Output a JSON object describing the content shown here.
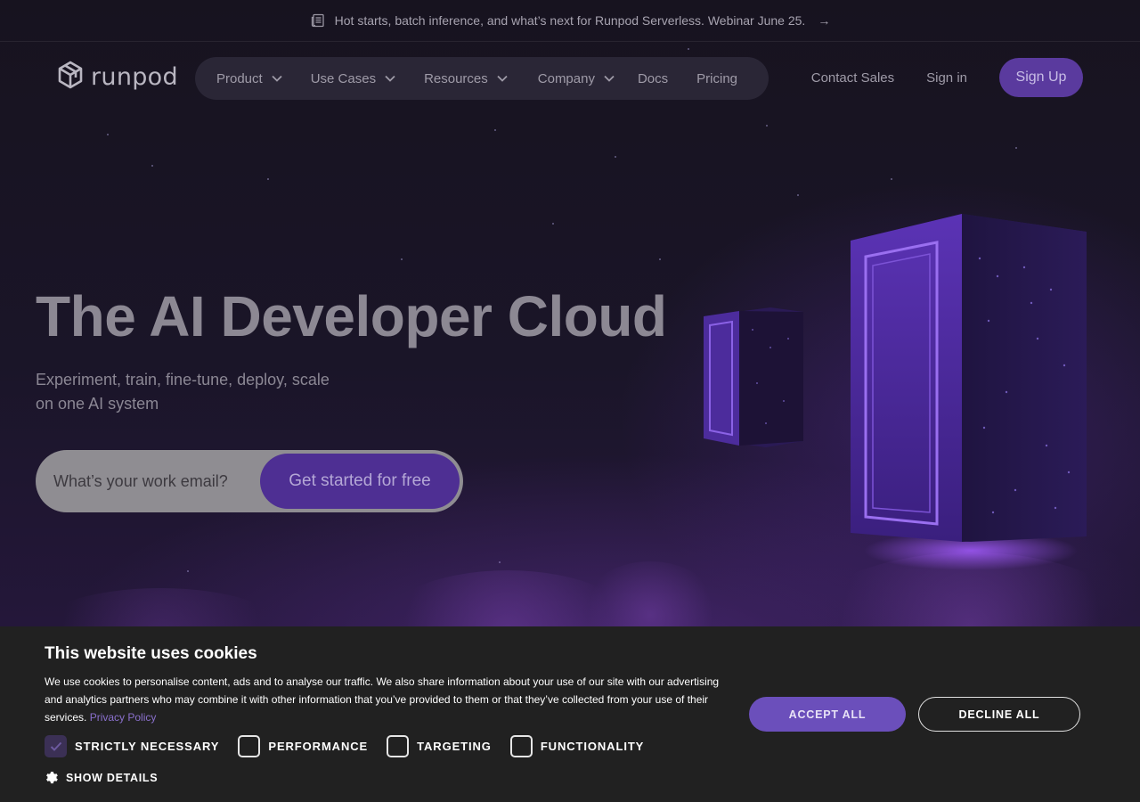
{
  "announcement": {
    "text": "Hot starts, batch inference, and what’s next for Runpod Serverless. Webinar June 25.",
    "icon": "newspaper-icon",
    "arrow": "→"
  },
  "nav": {
    "logo_text": "runpod",
    "items": [
      {
        "label": "Product",
        "has_dropdown": true
      },
      {
        "label": "Use Cases",
        "has_dropdown": true
      },
      {
        "label": "Resources",
        "has_dropdown": true
      },
      {
        "label": "Company",
        "has_dropdown": true
      },
      {
        "label": "Docs",
        "has_dropdown": false
      },
      {
        "label": "Pricing",
        "has_dropdown": false
      }
    ],
    "contact_sales": "Contact Sales",
    "sign_in": "Sign in",
    "sign_up": "Sign Up"
  },
  "hero": {
    "title": "The AI Developer Cloud",
    "subtitle_line1": "Experiment, train, fine-tune, deploy, scale",
    "subtitle_line2": "on one AI system",
    "email_placeholder": "What’s your work email?",
    "cta": "Get started for free"
  },
  "cookie": {
    "title": "This website uses cookies",
    "body": "We use cookies to personalise content, ads and to analyse our traffic. We also share information about your use of our site with our advertising and analytics partners who may combine it with other information that you’ve provided to them or that they’ve collected from your use of their services.",
    "privacy_link": "Privacy Policy",
    "options": [
      {
        "label": "STRICTLY NECESSARY",
        "checked": true
      },
      {
        "label": "PERFORMANCE",
        "checked": false
      },
      {
        "label": "TARGETING",
        "checked": false
      },
      {
        "label": "FUNCTIONALITY",
        "checked": false
      }
    ],
    "show_details": "SHOW DETAILS",
    "accept_all": "ACCEPT ALL",
    "decline_all": "DECLINE ALL"
  },
  "colors": {
    "accent": "#5a3a9e",
    "cookie_bg": "#212121",
    "accept": "#6b4fbb"
  }
}
